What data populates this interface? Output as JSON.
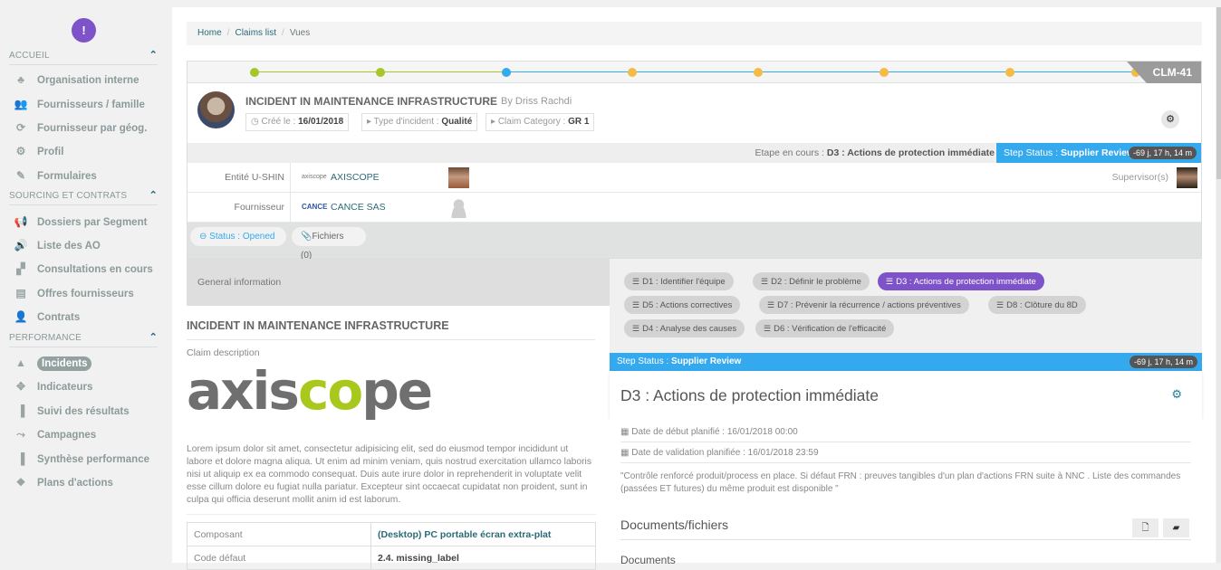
{
  "sidebar": {
    "alert_icon": "!",
    "sections": [
      {
        "title": "ACCUEIL",
        "items": [
          {
            "label": "Organisation interne",
            "icon": "sitemap-icon"
          },
          {
            "label": "Fournisseurs / famille",
            "icon": "users-icon"
          },
          {
            "label": "Fournisseur par géog.",
            "icon": "geo-users-icon"
          },
          {
            "label": "Profil",
            "icon": "gear-icon"
          },
          {
            "label": "Formulaires",
            "icon": "edit-icon"
          }
        ]
      },
      {
        "title": "SOURCING ET CONTRATS",
        "items": [
          {
            "label": "Dossiers par Segment",
            "icon": "bullhorn-icon"
          },
          {
            "label": "Liste des AO",
            "icon": "volume-icon"
          },
          {
            "label": "Consultations en cours",
            "icon": "binoculars-icon"
          },
          {
            "label": "Offres fournisseurs",
            "icon": "document-icon"
          },
          {
            "label": "Contrats",
            "icon": "user-contract-icon"
          }
        ]
      },
      {
        "title": "PERFORMANCE",
        "items": [
          {
            "label": "Incidents",
            "icon": "cone-icon",
            "active": true
          },
          {
            "label": "Indicateurs",
            "icon": "arrows-icon"
          },
          {
            "label": "Suivi des résultats",
            "icon": "bar-chart-icon"
          },
          {
            "label": "Campagnes",
            "icon": "nodes-icon"
          },
          {
            "label": "Synthèse performance",
            "icon": "bar-chart-icon"
          },
          {
            "label": "Plans d'actions",
            "icon": "cubes-icon"
          }
        ]
      }
    ]
  },
  "breadcrumb": {
    "home": "Home",
    "claims": "Claims list",
    "current": "Vues",
    "sep": "/"
  },
  "timeline": {
    "steps": [
      "done",
      "done",
      "current",
      "pending",
      "pending",
      "pending",
      "pending",
      "pending"
    ],
    "colors": {
      "done": "#a6c62a",
      "current": "#34a9ee",
      "pending": "#f4bc45"
    },
    "claim_id": "CLM-41"
  },
  "claim": {
    "title": "INCIDENT IN MAINTENANCE INFRASTRUCTURE",
    "by": "By Driss Rachdi",
    "created_label": "Créé le :",
    "created_value": "16/01/2018",
    "type_label": "Type d'incident :",
    "type_value": "Qualité",
    "category_label": "Claim Category :",
    "category_value": "GR 1",
    "etape_label": "Etape en cours :",
    "etape_value": "D3 : Actions de protection immédiate",
    "step_status_label": "Step Status :",
    "step_status_value": "Supplier Review",
    "timer": "-69 j, 17 h, 14 m",
    "entity_label": "Entité U-SHIN",
    "entity_logo": "axiscope",
    "entity_value": "AXISCOPE",
    "supplier_label": "Fournisseur",
    "supplier_logo": "CANCE",
    "supplier_value": "CANCE SAS",
    "supervisors_label": "Supervisor(s)",
    "status_label": "Status : Opened",
    "files_label": "Fichiers (0)"
  },
  "general": {
    "tab_label": "General information",
    "title": "INCIDENT IN MAINTENANCE INFRASTRUCTURE",
    "desc_label": "Claim description",
    "logo_text_a": "axis",
    "logo_text_b": "co",
    "logo_text_c": "pe",
    "lorem": "Lorem ipsum dolor sit amet, consectetur adipisicing elit, sed do eiusmod tempor incididunt ut labore et dolore magna aliqua. Ut enim ad minim veniam, quis nostrud exercitation ullamco laboris nisi ut aliquip ex ea commodo consequat. Duis aute irure dolor in reprehenderit in voluptate velit esse cillum dolore eu fugiat nulla pariatur. Excepteur sint occaecat cupidatat non proident, sunt in culpa qui officia deserunt mollit anim id est laborum.",
    "table": [
      {
        "key": "Composant",
        "value": "(Desktop) PC portable écran extra-plat"
      },
      {
        "key": "Code défaut",
        "value": "2.4. missing_label"
      }
    ]
  },
  "steps8d": {
    "buttons": [
      {
        "label": "D1 : Identifier l'équipe"
      },
      {
        "label": "D2 : Définir le problème"
      },
      {
        "label": "D3 : Actions de protection immédiate",
        "active": true
      },
      {
        "label": "D5 : Actions correctives"
      },
      {
        "label": "D7 : Prévenir la récurrence / actions préventives"
      },
      {
        "label": "D8 : Clôture du 8D"
      },
      {
        "label": "D4 : Analyse des causes"
      },
      {
        "label": "D6 : Vérification de l'efficacité"
      }
    ],
    "step_status_label": "Step Status :",
    "step_status_value": "Supplier Review",
    "timer": "-69 j, 17 h, 14 m",
    "current_title": "D3 : Actions de protection immédiate",
    "date_start": "Date de début planifié : 16/01/2018 00:00",
    "date_validation": "Date de validation planifiée : 16/01/2018 23:59",
    "quote": "\"Contrôle renforcé produit/process en place. Si défaut FRN : preuves tangibles d'un plan d'actions FRN suite à NNC . Liste des commandes (passées ET futures) du même produit est disponible \"",
    "docs_title": "Documents/fichiers",
    "docs_sub": "Documents"
  }
}
